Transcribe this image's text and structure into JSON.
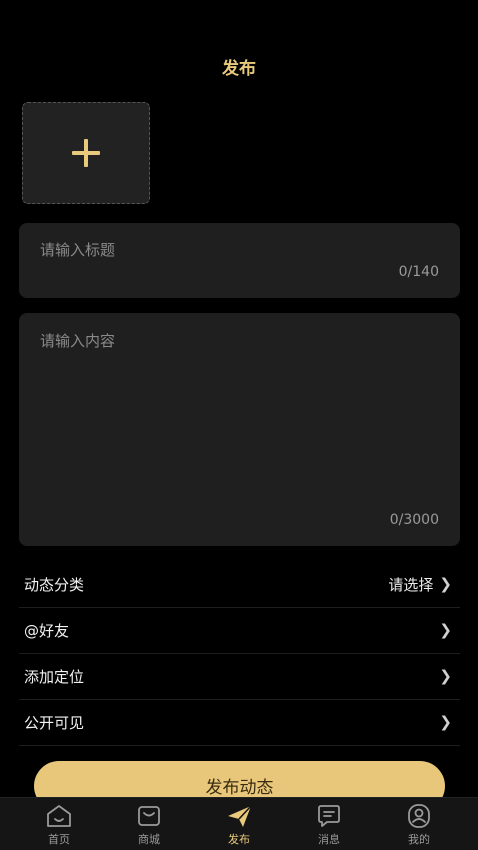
{
  "header": {
    "title": "发布"
  },
  "upload": {
    "icon": "plus-icon"
  },
  "title_input": {
    "placeholder": "请输入标题",
    "counter": "0/140"
  },
  "content_input": {
    "placeholder": "请输入内容",
    "counter": "0/3000"
  },
  "options": [
    {
      "label": "动态分类",
      "value": "请选择",
      "icon": "chevron-right-icon"
    },
    {
      "label": "@好友",
      "value": "",
      "icon": "chevron-right-icon"
    },
    {
      "label": "添加定位",
      "value": "",
      "icon": "chevron-right-icon"
    },
    {
      "label": "公开可见",
      "value": "",
      "icon": "chevron-right-icon"
    }
  ],
  "publish_button": {
    "label": "发布动态"
  },
  "tabbar": {
    "items": [
      {
        "label": "首页",
        "icon": "home-icon",
        "active": false
      },
      {
        "label": "商城",
        "icon": "shop-icon",
        "active": false
      },
      {
        "label": "发布",
        "icon": "send-icon",
        "active": true
      },
      {
        "label": "消息",
        "icon": "message-icon",
        "active": false
      },
      {
        "label": "我的",
        "icon": "profile-icon",
        "active": false
      }
    ]
  },
  "colors": {
    "accent": "#E9C97C",
    "button": "#E8C77B",
    "background": "#000000",
    "card": "#1F1F1F"
  }
}
